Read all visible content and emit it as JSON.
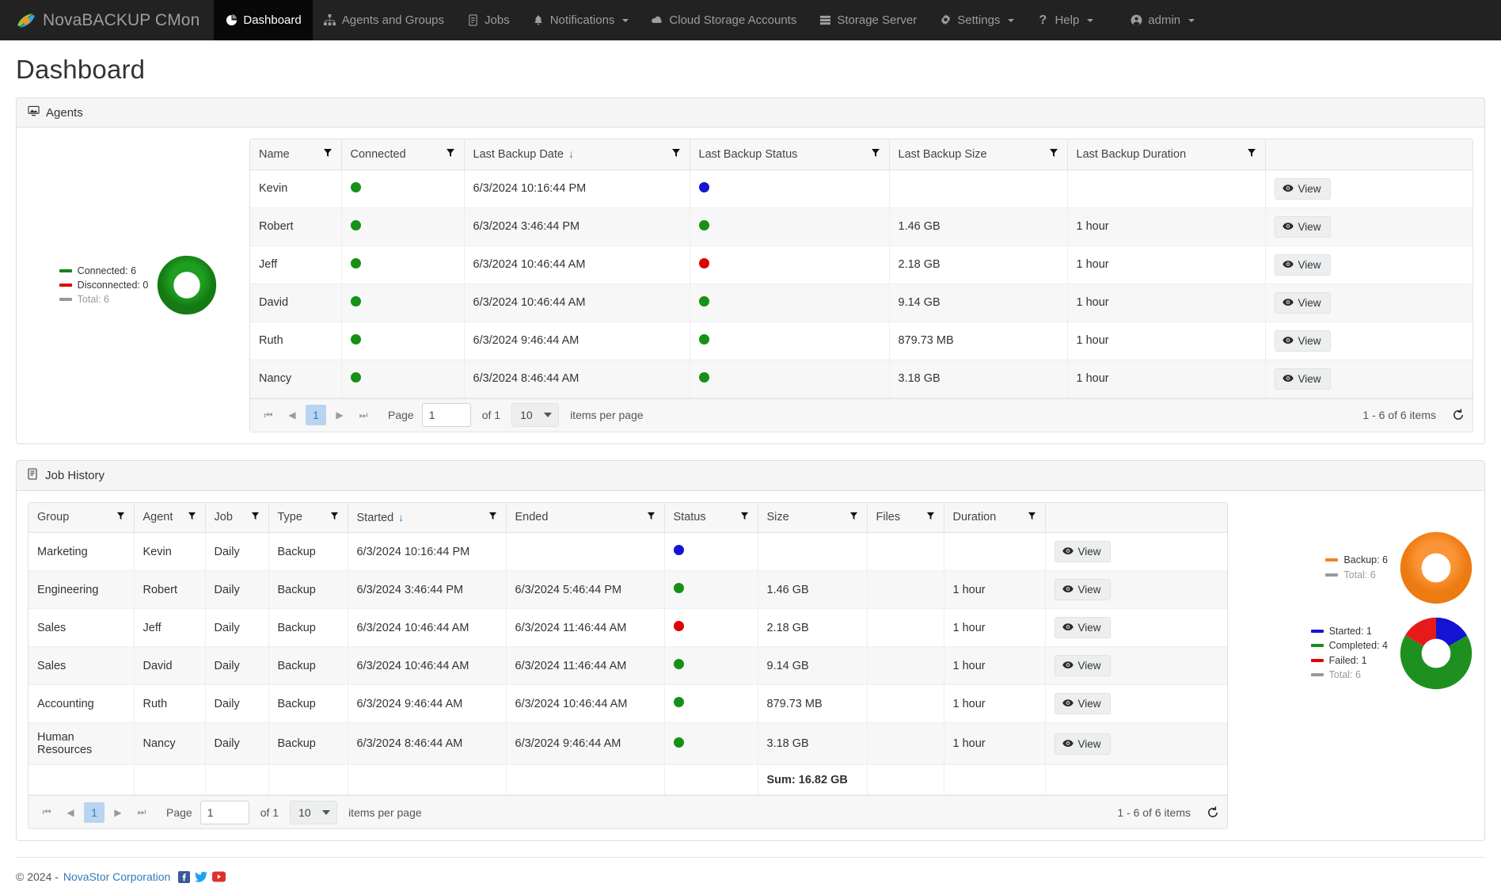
{
  "nav": {
    "brand": "NovaBACKUP CMon",
    "items": [
      {
        "label": "Dashboard",
        "icon": "pie-chart-icon",
        "active": true,
        "caret": false
      },
      {
        "label": "Agents and Groups",
        "icon": "sitemap-icon",
        "active": false,
        "caret": false
      },
      {
        "label": "Jobs",
        "icon": "tasks-icon",
        "active": false,
        "caret": false
      },
      {
        "label": "Notifications",
        "icon": "bell-icon",
        "active": false,
        "caret": true
      },
      {
        "label": "Cloud Storage Accounts",
        "icon": "cloud-icon",
        "active": false,
        "caret": false
      },
      {
        "label": "Storage Server",
        "icon": "server-icon",
        "active": false,
        "caret": false
      },
      {
        "label": "Settings",
        "icon": "gear-icon",
        "active": false,
        "caret": true
      },
      {
        "label": "Help",
        "icon": "question-icon",
        "active": false,
        "caret": true
      },
      {
        "label": "admin",
        "icon": "user-icon",
        "active": false,
        "caret": true
      }
    ]
  },
  "page": {
    "title": "Dashboard"
  },
  "agents_panel": {
    "title": "Agents",
    "chart_data": {
      "type": "pie",
      "title": "Agents",
      "categories": [
        "Connected",
        "Disconnected",
        "Total"
      ],
      "values": [
        6,
        0,
        6
      ],
      "colors": [
        "#1a7f1a",
        "#e00000",
        "#9a9a9a"
      ],
      "legend": [
        {
          "label": "Connected: 6",
          "color": "#1a7f1a",
          "muted": false
        },
        {
          "label": "Disconnected: 0",
          "color": "#e00000",
          "muted": false
        },
        {
          "label": "Total: 6",
          "color": "#9a9a9a",
          "muted": true
        }
      ]
    },
    "columns": [
      "Name",
      "Connected",
      "Last Backup Date",
      "Last Backup Status",
      "Last Backup Size",
      "Last Backup Duration",
      ""
    ],
    "sorted_column": "Last Backup Date",
    "sort_dir": "desc",
    "rows": [
      {
        "name": "Kevin",
        "connected": "green",
        "date": "6/3/2024 10:16:44 PM",
        "status": "blue",
        "size": "",
        "duration": "",
        "view": "View"
      },
      {
        "name": "Robert",
        "connected": "green",
        "date": "6/3/2024 3:46:44 PM",
        "status": "green",
        "size": "1.46 GB",
        "duration": "1 hour",
        "view": "View"
      },
      {
        "name": "Jeff",
        "connected": "green",
        "date": "6/3/2024 10:46:44 AM",
        "status": "red",
        "size": "2.18 GB",
        "duration": "1 hour",
        "view": "View"
      },
      {
        "name": "David",
        "connected": "green",
        "date": "6/3/2024 10:46:44 AM",
        "status": "green",
        "size": "9.14 GB",
        "duration": "1 hour",
        "view": "View"
      },
      {
        "name": "Ruth",
        "connected": "green",
        "date": "6/3/2024 9:46:44 AM",
        "status": "green",
        "size": "879.73 MB",
        "duration": "1 hour",
        "view": "View"
      },
      {
        "name": "Nancy",
        "connected": "green",
        "date": "6/3/2024 8:46:44 AM",
        "status": "green",
        "size": "3.18 GB",
        "duration": "1 hour",
        "view": "View"
      }
    ],
    "pager": {
      "page_number": "1",
      "page_label": "Page",
      "page_value": "1",
      "of_label": "of 1",
      "items_per_page_value": "10",
      "items_per_page_label": "items per page",
      "count": "1 - 6 of 6 items"
    }
  },
  "jobs_panel": {
    "title": "Job History",
    "columns": [
      "Group",
      "Agent",
      "Job",
      "Type",
      "Started",
      "Ended",
      "Status",
      "Size",
      "Files",
      "Duration",
      ""
    ],
    "sorted_column": "Started",
    "sort_dir": "desc",
    "rows": [
      {
        "group": "Marketing",
        "agent": "Kevin",
        "job": "Daily",
        "type": "Backup",
        "started": "6/3/2024 10:16:44 PM",
        "ended": "",
        "status": "blue",
        "size": "",
        "files": "",
        "duration": "",
        "view": "View"
      },
      {
        "group": "Engineering",
        "agent": "Robert",
        "job": "Daily",
        "type": "Backup",
        "started": "6/3/2024 3:46:44 PM",
        "ended": "6/3/2024 5:46:44 PM",
        "status": "green",
        "size": "1.46 GB",
        "files": "",
        "duration": "1 hour",
        "view": "View"
      },
      {
        "group": "Sales",
        "agent": "Jeff",
        "job": "Daily",
        "type": "Backup",
        "started": "6/3/2024 10:46:44 AM",
        "ended": "6/3/2024 11:46:44 AM",
        "status": "red",
        "size": "2.18 GB",
        "files": "",
        "duration": "1 hour",
        "view": "View"
      },
      {
        "group": "Sales",
        "agent": "David",
        "job": "Daily",
        "type": "Backup",
        "started": "6/3/2024 10:46:44 AM",
        "ended": "6/3/2024 11:46:44 AM",
        "status": "green",
        "size": "9.14 GB",
        "files": "",
        "duration": "1 hour",
        "view": "View"
      },
      {
        "group": "Accounting",
        "agent": "Ruth",
        "job": "Daily",
        "type": "Backup",
        "started": "6/3/2024 9:46:44 AM",
        "ended": "6/3/2024 10:46:44 AM",
        "status": "green",
        "size": "879.73 MB",
        "files": "",
        "duration": "1 hour",
        "view": "View"
      },
      {
        "group": "Human Resources",
        "agent": "Nancy",
        "job": "Daily",
        "type": "Backup",
        "started": "6/3/2024 8:46:44 AM",
        "ended": "6/3/2024 9:46:44 AM",
        "status": "green",
        "size": "3.18 GB",
        "files": "",
        "duration": "1 hour",
        "view": "View"
      }
    ],
    "sum_label": "Sum: 16.82 GB",
    "pager": {
      "page_number": "1",
      "page_label": "Page",
      "page_value": "1",
      "of_label": "of 1",
      "items_per_page_value": "10",
      "items_per_page_label": "items per page",
      "count": "1 - 6 of 6 items"
    },
    "chart_data": [
      {
        "type": "pie",
        "title": "Job Types",
        "categories": [
          "Backup",
          "Total"
        ],
        "values": [
          6,
          6
        ],
        "colors": [
          "#f58220",
          "#9a9a9a"
        ],
        "legend": [
          {
            "label": "Backup: 6",
            "color": "#f58220",
            "muted": false
          },
          {
            "label": "Total: 6",
            "color": "#9a9a9a",
            "muted": true
          }
        ]
      },
      {
        "type": "pie",
        "title": "Job Status",
        "categories": [
          "Started",
          "Completed",
          "Failed",
          "Total"
        ],
        "values": [
          1,
          4,
          1,
          6
        ],
        "colors": [
          "#1414d2",
          "#1a8a1a",
          "#e00000",
          "#9a9a9a"
        ],
        "legend": [
          {
            "label": "Started: 1",
            "color": "#1414d2",
            "muted": false
          },
          {
            "label": "Completed: 4",
            "color": "#1a8a1a",
            "muted": false
          },
          {
            "label": "Failed: 1",
            "color": "#e00000",
            "muted": false
          },
          {
            "label": "Total: 6",
            "color": "#9a9a9a",
            "muted": true
          }
        ]
      }
    ]
  },
  "footer": {
    "copyright": "© 2024 - ",
    "company": "NovaStor Corporation",
    "social": [
      "facebook-icon",
      "twitter-icon",
      "youtube-icon"
    ]
  }
}
